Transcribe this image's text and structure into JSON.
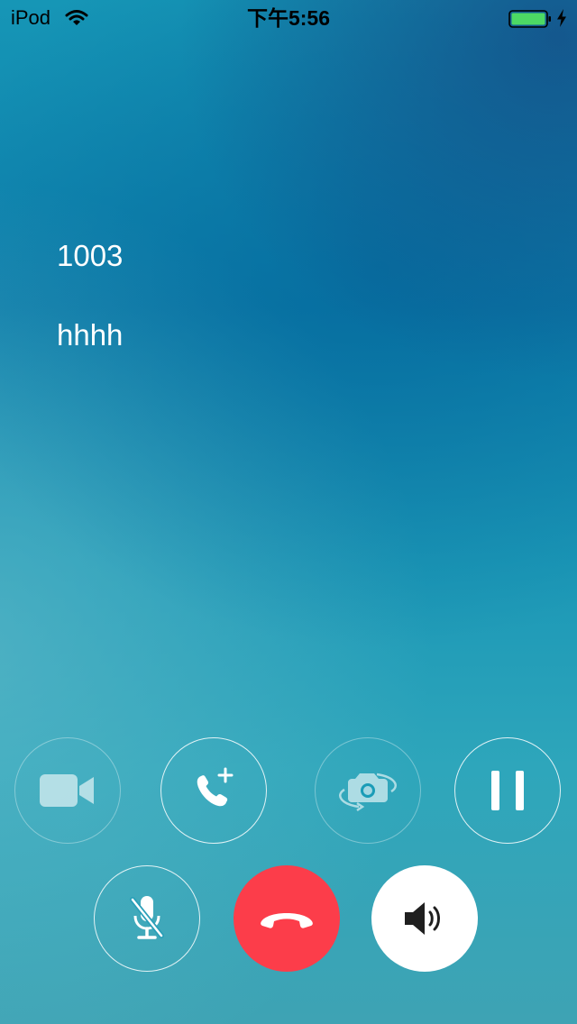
{
  "status_bar": {
    "carrier": "iPod",
    "time": "下午5:56",
    "wifi_icon": "wifi-icon",
    "battery_icon": "battery-icon",
    "charging_icon": "charging-bolt-icon",
    "battery_color": "#4cd964"
  },
  "call": {
    "number": "1003",
    "name": "hhhh"
  },
  "controls": {
    "row1": [
      {
        "name": "video-button",
        "icon": "video-camera-icon",
        "enabled": false
      },
      {
        "name": "add-call-button",
        "icon": "phone-plus-icon",
        "enabled": true
      },
      {
        "name": "switch-camera-button",
        "icon": "camera-rotate-icon",
        "enabled": false
      },
      {
        "name": "hold-button",
        "icon": "pause-icon",
        "enabled": true
      }
    ],
    "row2": [
      {
        "name": "mute-button",
        "icon": "microphone-off-icon",
        "enabled": true
      },
      {
        "name": "hang-up-button",
        "icon": "hang-up-icon",
        "color": "#fc3d4a"
      },
      {
        "name": "speaker-button",
        "icon": "speaker-icon",
        "active": true,
        "color": "#ffffff"
      }
    ]
  }
}
